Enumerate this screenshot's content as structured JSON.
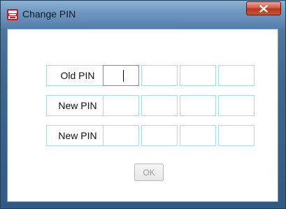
{
  "window": {
    "title": "Change PIN",
    "icon": "shield-logo-icon",
    "close_icon": "close-x-icon"
  },
  "form": {
    "rows": [
      {
        "label": "Old PIN",
        "cells": [
          "",
          "",
          "",
          ""
        ],
        "focused_cell": 0
      },
      {
        "label": "New PIN",
        "cells": [
          "",
          "",
          "",
          ""
        ]
      },
      {
        "label": "New PIN",
        "cells": [
          "",
          "",
          "",
          ""
        ]
      }
    ],
    "ok_label": "OK",
    "ok_enabled": false
  },
  "colors": {
    "cell_border": "#a9dbe5",
    "titlebar": "#6d96bf",
    "close_button": "#c8553d"
  }
}
